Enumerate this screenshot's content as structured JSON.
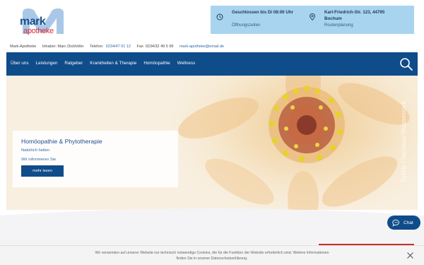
{
  "logo": {
    "word1": "mark",
    "word2": "apotheke",
    "colors": {
      "blue": "#1a4f8a",
      "red": "#d92a3a",
      "lightblue": "#a9c8e8"
    }
  },
  "info": {
    "hours": {
      "title": "Geschlossen bis Di 08:00 Uhr",
      "subtitle": "Öffnungszeiten",
      "icon": "clock-icon"
    },
    "address": {
      "title": "Karl-Friedrich-Str. 123, 44795 Bochum",
      "subtitle": "Routenplanung",
      "icon": "location-pin-icon"
    }
  },
  "contact": {
    "name": "Mark-Apotheke",
    "owner": "Inhaber: Marc Dickhöfer",
    "phone_label": "Telefon:",
    "phone": "0234/47 01 12",
    "fax": "Fax: 0234/32 49 5 99",
    "email": "mark-apotheke@email.de"
  },
  "nav": {
    "items": [
      "Über uns",
      "Leistungen",
      "Ratgeber",
      "Krankheiten & Therapie",
      "Homöopathie",
      "Wellness"
    ],
    "search_icon": "search-icon"
  },
  "hero": {
    "credit": "Sylvie Corriveau/Shutterstock",
    "card": {
      "title": "Homöopathie & Phytotherapie",
      "line1": "Natürlich heilen",
      "line2": "Wir informieren Sie",
      "button": "mehr lesen"
    }
  },
  "chat": {
    "label": "Chat",
    "icon": "chat-bubble-icon"
  },
  "cookie": {
    "line1": "Wir verwenden auf unserer Website nur technisch notwendige Cookies, die für die Funktion der Website erforderlich sind. Weitere Informationen",
    "line2": "finden Sie in unserer Datenschutzerklärung.",
    "close_icon": "close-icon"
  },
  "colors": {
    "primary": "#0f4c8a",
    "infobox": "#a9d4f0",
    "accent_red": "#d42a2a"
  }
}
